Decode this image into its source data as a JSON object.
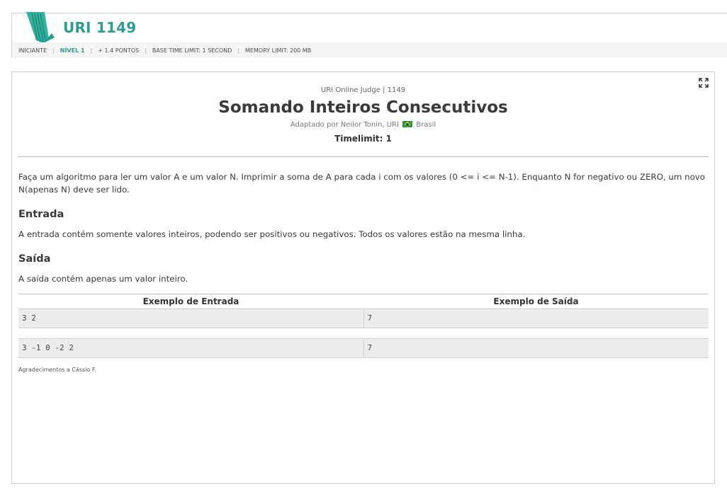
{
  "header": {
    "problem_id": "URI 1149",
    "meta": {
      "category": "INICIANTE",
      "level": "NÍVEL 1",
      "points": "+ 1.4 PONTOS",
      "base_time": "BASE TIME LIMIT: 1 SECOND",
      "memory": "MEMORY LIMIT: 200 MB"
    }
  },
  "problem": {
    "judge_line": "URI Online Judge | 1149",
    "title": "Somando Inteiros Consecutivos",
    "author_prefix": "Adaptado por Neilor Tonin, URI",
    "country": "Brasil",
    "timelimit": "Timelimit: 1",
    "description": "Faça um algoritmo para ler um valor A e um valor N. Imprimir a soma de A para cada i com os valores (0 <= i <= N-1). Enquanto N for negativo ou ZERO, um novo N(apenas N) deve ser lido.",
    "input_heading": "Entrada",
    "input_text": "A entrada contém somente valores inteiros, podendo ser positivos ou negativos. Todos os valores estão na mesma linha.",
    "output_heading": "Saída",
    "output_text": "A saída contém apenas um valor inteiro.",
    "examples": {
      "input_header": "Exemplo de Entrada",
      "output_header": "Exemplo de Saída",
      "rows": [
        {
          "input": "3 2",
          "output": "7"
        },
        {
          "input": "3 -1 0 -2 2",
          "output": "7"
        }
      ]
    },
    "thanks": "Agradecimentos a Cássio F."
  },
  "colors": {
    "accent": "#2a9d8f",
    "flag_green": "#2e9a3c"
  },
  "icons": {
    "logo": "uri-logo-icon",
    "expand": "expand-icon",
    "flag": "brazil-flag-icon"
  }
}
